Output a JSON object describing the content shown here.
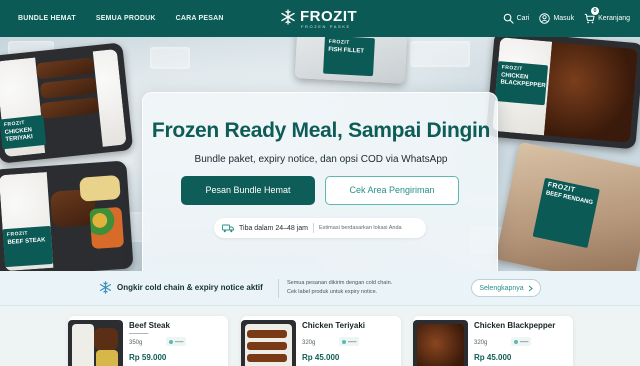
{
  "nav": {
    "links": [
      "BUNDLE HEMAT",
      "SEMUA PRODUK",
      "CARA PESAN"
    ],
    "brand": "FROZIT",
    "brand_sub": "FROZEN PASKE",
    "search": "Cari",
    "login": "Masuk",
    "cart": "Keranjang",
    "cart_count": "0",
    "colors": {
      "bar": "#0b5a55",
      "accent": "#5cb8b1"
    }
  },
  "hero": {
    "title": "Frozen Ready Meal, Sampai Dingin",
    "subtitle": "Bundle paket, expiry notice, dan opsi COD via WhatsApp",
    "primary_cta": "Pesan Bundle Hemat",
    "secondary_cta": "Cek Area Pengiriman",
    "eta": "Tiba dalam 24–48 jam",
    "eta_note": "Estimasi berdasarkan lokasi Anda",
    "packs": [
      {
        "brand": "FROZIT",
        "name": "CHICKEN TERIYAKI"
      },
      {
        "brand": "FROZIT",
        "name": "BEEF STEAK"
      },
      {
        "brand": "FROZIT",
        "name": "FISH FILLET"
      },
      {
        "brand": "FROZIT",
        "name": "CHICKEN BLACKPEPPER"
      },
      {
        "brand": "FROZIT",
        "name": "BEEF RENDANG"
      }
    ]
  },
  "info": {
    "title": "Ongkir cold chain & expiry notice aktif",
    "line1": "Semua pesanan dikirim dengan cold chain.",
    "line2": "Cek label produk untuk expiry notice.",
    "button": "Selengkapnya"
  },
  "products": [
    {
      "name": "Beef Steak",
      "weight": "350g",
      "price": "Rp 59.000"
    },
    {
      "name": "Chicken Teriyaki",
      "weight": "320g",
      "price": "Rp 45.000"
    },
    {
      "name": "Chicken Blackpepper",
      "weight": "320g",
      "price": "Rp 45.000"
    }
  ]
}
